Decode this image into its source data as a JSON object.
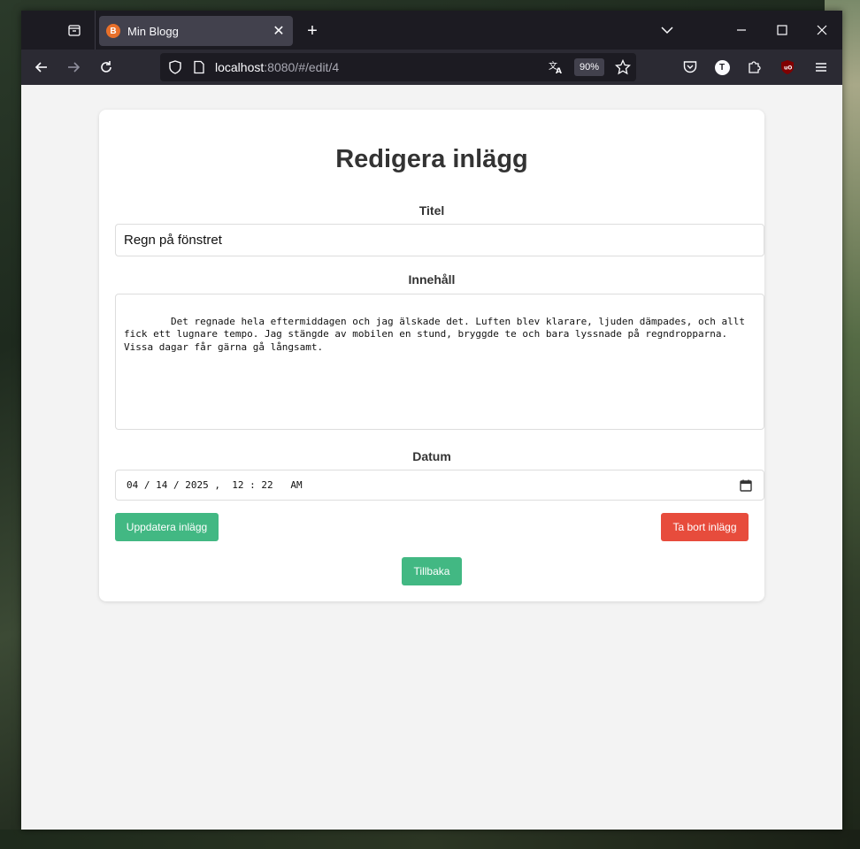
{
  "browser": {
    "tab": {
      "title": "Min Blogg",
      "favicon_letter": "B"
    },
    "url": {
      "host": "localhost",
      "rest": ":8080/#/edit/4"
    },
    "zoom": "90%",
    "account_initial": "T"
  },
  "page": {
    "heading": "Redigera inlägg",
    "title_label": "Titel",
    "title_value": "Regn på fönstret",
    "content_label": "Innehåll",
    "content_value": "Det regnade hela eftermiddagen och jag älskade det. Luften blev klarare, ljuden dämpades, och allt fick ett lugnare tempo. Jag stängde av mobilen en stund, bryggde te och bara lyssnade på regndropparna. Vissa dagar får gärna gå långsamt.",
    "date_label": "Datum",
    "date_value": "04 / 14 / 2025 ,  12 : 22   AM",
    "update_button": "Uppdatera inlägg",
    "delete_button": "Ta bort inlägg",
    "back_button": "Tillbaka"
  },
  "colors": {
    "primary": "#42b883",
    "danger": "#e74c3c",
    "text": "#333333"
  }
}
